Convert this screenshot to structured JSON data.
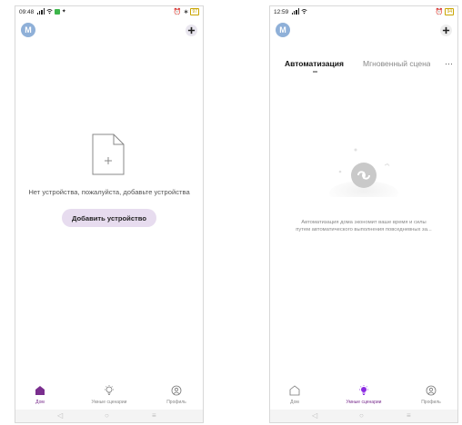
{
  "left_screen": {
    "status": {
      "time": "09:48",
      "battery": "97"
    },
    "avatar_letter": "M",
    "empty_message": "Нет устройства, пожалуйста, добавьте устройства",
    "add_device_button": "Добавить устройство",
    "tabs": [
      {
        "label": "Дом",
        "active": true
      },
      {
        "label": "Умные сценарии",
        "active": false
      },
      {
        "label": "Профиль",
        "active": false
      }
    ]
  },
  "right_screen": {
    "status": {
      "time": "12:59",
      "battery": "94"
    },
    "avatar_letter": "M",
    "top_tabs": [
      "Автоматизация",
      "Мгновенный сцена"
    ],
    "description_line1": "Автоматизация дома экономит ваше время и силы",
    "description_line2": "путем автоматического выполнения повседневных за...",
    "tabs": [
      {
        "label": "Дом",
        "active": false
      },
      {
        "label": "Умные сценарии",
        "active": true
      },
      {
        "label": "Профиль",
        "active": false
      }
    ]
  },
  "colors": {
    "accent": "#7a2e8e",
    "avatar": "#8fb0d8",
    "button_bg": "#e7dcef",
    "smart_bulb": "#8b2be2"
  }
}
